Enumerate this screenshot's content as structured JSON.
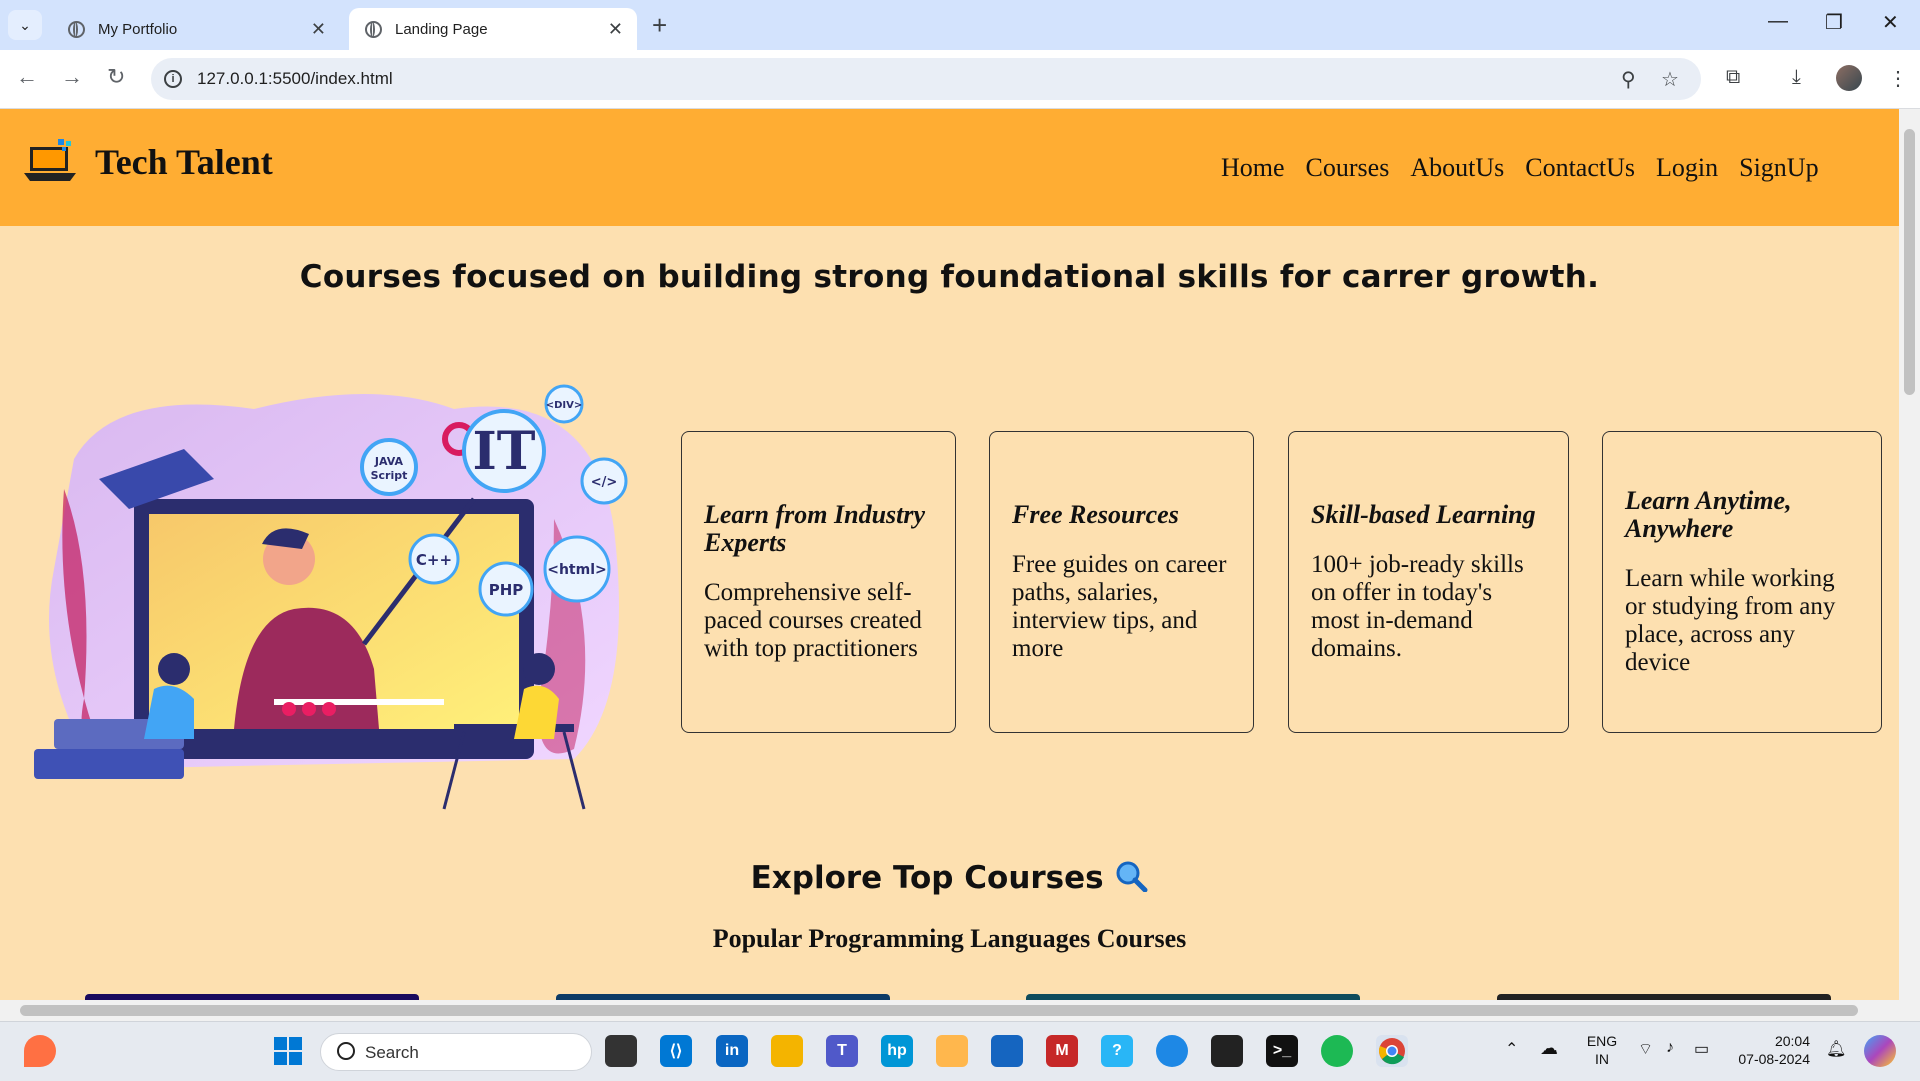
{
  "browser": {
    "tabs": [
      {
        "title": "My Portfolio",
        "active": false
      },
      {
        "title": "Landing Page",
        "active": true
      }
    ],
    "url": "127.0.0.1:5500/index.html"
  },
  "site": {
    "brand": "Tech Talent",
    "nav": [
      "Home",
      "Courses",
      "AboutUs",
      "ContactUs",
      "Login",
      "SignUp"
    ],
    "hero_title": "Courses focused on building strong foundational skills for carrer growth.",
    "features": [
      {
        "title": "Learn from Industry Experts",
        "text": "Comprehensive self-paced courses created with top practitioners"
      },
      {
        "title": "Free Resources",
        "text": "Free guides on career paths, salaries, interview tips, and more"
      },
      {
        "title": "Skill-based Learning",
        "text": "100+ job-ready skills on offer in today's most in-demand domains."
      },
      {
        "title": "Learn Anytime, Anywhere",
        "text": "Learn while working or studying from any place, across any device"
      }
    ],
    "explore_title": "Explore Top Courses",
    "explore_icon": "magnifier-icon",
    "subheading": "Popular Programming Languages Courses",
    "illustration_labels": [
      "JAVA Script",
      "IT",
      "<DIV>",
      "</>",
      "C++",
      "PHP",
      "<html>"
    ],
    "colors": {
      "header": "#ffad33",
      "background": "#fde0b0"
    }
  },
  "taskbar": {
    "search_placeholder": "Search",
    "language": "ENG",
    "region": "IN",
    "time": "20:04",
    "date": "07-08-2024"
  }
}
